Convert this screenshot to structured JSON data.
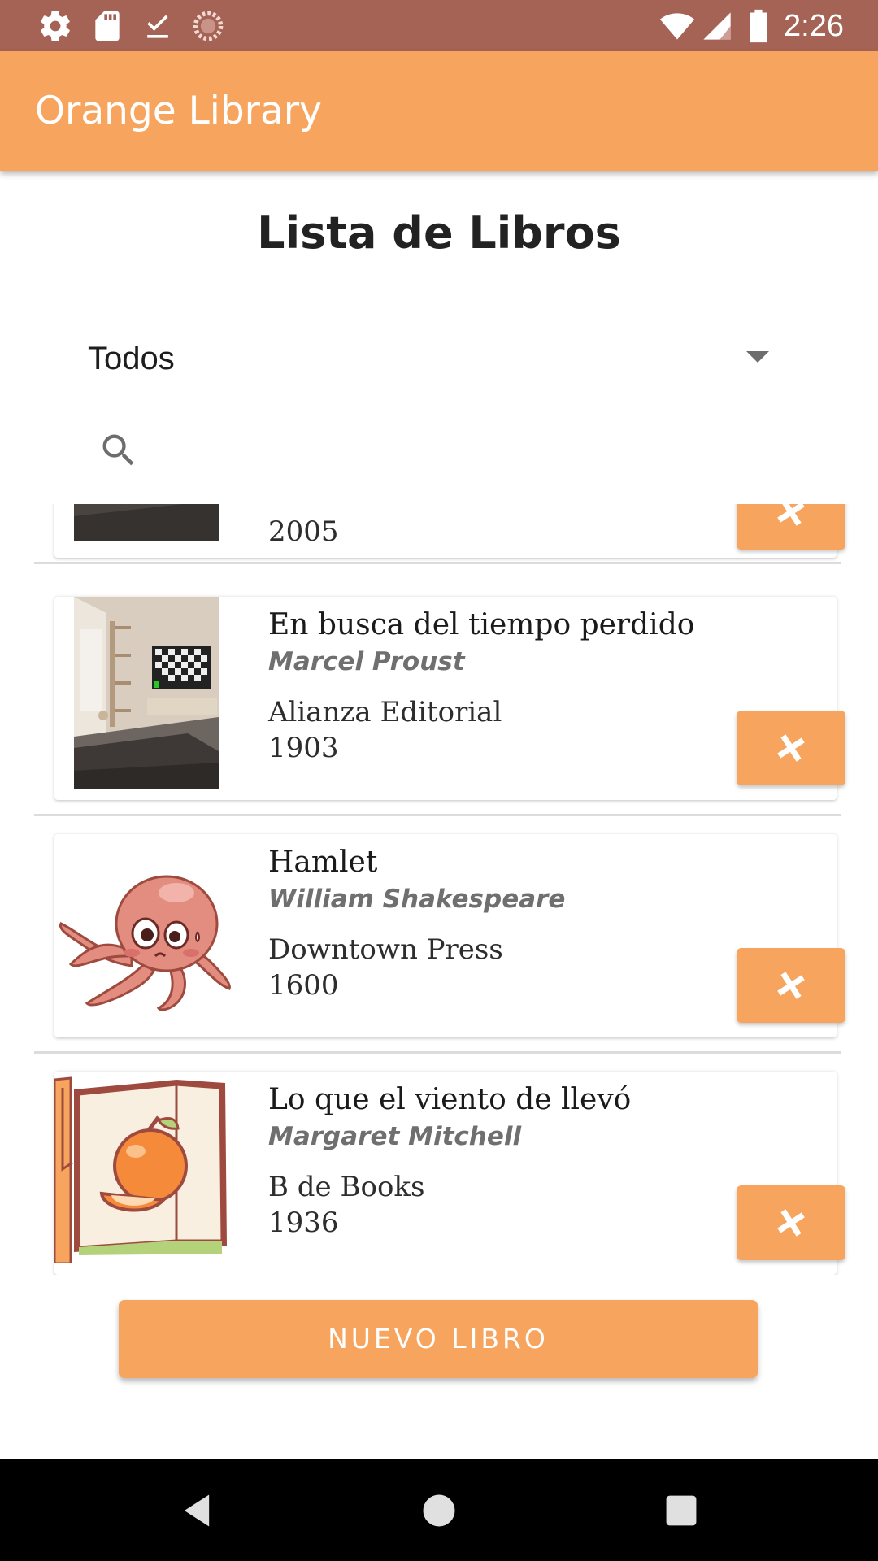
{
  "status_bar": {
    "time": "2:26",
    "left_icons": [
      "gear-icon",
      "sd-card-icon",
      "download-done-icon",
      "sync-circle-icon"
    ],
    "right_icons": [
      "wifi-icon",
      "signal-icon",
      "battery-icon"
    ]
  },
  "app_bar": {
    "title": "Orange Library"
  },
  "page_title": "Lista de Libros",
  "filter": {
    "selected": "Todos"
  },
  "search": {
    "placeholder": "",
    "value": ""
  },
  "books": [
    {
      "title": "",
      "author": "",
      "publisher": "",
      "year": "2005"
    },
    {
      "title": "En busca del tiempo perdido",
      "author": "Marcel Proust",
      "publisher": "Alianza Editorial",
      "year": "1903"
    },
    {
      "title": "Hamlet",
      "author": "William Shakespeare",
      "publisher": "Downtown Press",
      "year": "1600"
    },
    {
      "title": "Lo que el viento de llevó",
      "author": "Margaret Mitchell",
      "publisher": "B de Books",
      "year": "1936"
    }
  ],
  "new_button": {
    "label": "NUEVO LIBRO"
  },
  "colors": {
    "accent": "#f7a55e",
    "status_bar": "#a56355",
    "nav_bar": "#000000"
  }
}
